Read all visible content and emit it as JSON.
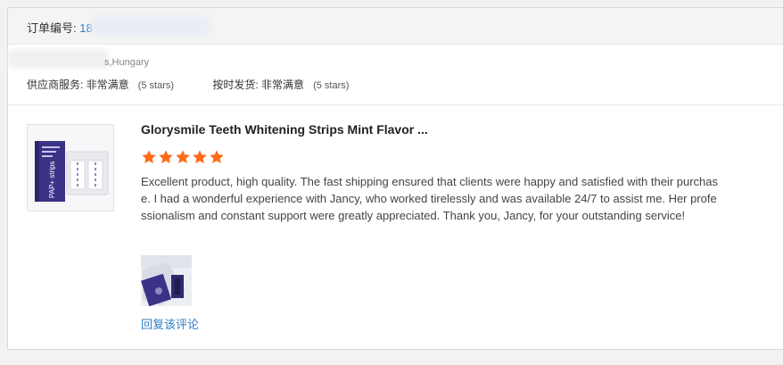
{
  "order": {
    "label": "订单编号: ",
    "number_prefix": "18"
  },
  "buyer": {
    "location": "s,Hungary"
  },
  "ratings": [
    {
      "label": "供应商服务: ",
      "value": "非常满意",
      "stars_note": "(5 stars)",
      "stars": 5
    },
    {
      "label": "按时发货: ",
      "value": "非常满意",
      "stars_note": "(5 stars)",
      "stars": 5
    }
  ],
  "review": {
    "product_title": "Glorysmile Teeth Whitening Strips Mint Flavor ...",
    "star_rating": 5,
    "star_max": 5,
    "text": "Excellent product, high quality. The fast shipping ensured that clients were happy and satisfied with their purchase. I had a wonderful experience with Jancy, who worked tirelessly and was available 24/7 to assist me. Her professionalism and constant support were greatly appreciated. Thank you, Jancy, for your outstanding service!",
    "reply_label": "回复该评论"
  },
  "colors": {
    "star": "#ff6a1a",
    "link": "#2f7fc3",
    "product_accent": "#3a3387"
  },
  "product_image": {
    "text": "PAP+ strips"
  }
}
